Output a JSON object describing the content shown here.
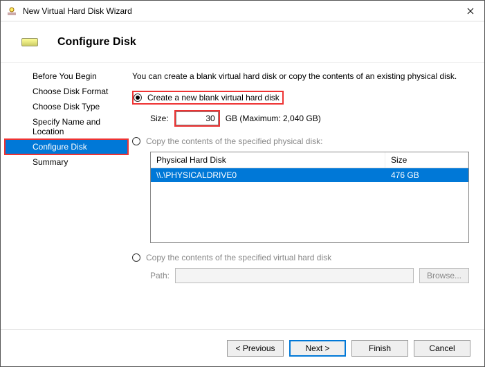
{
  "window": {
    "title": "New Virtual Hard Disk Wizard"
  },
  "header": {
    "title": "Configure Disk"
  },
  "nav": {
    "items": [
      {
        "label": "Before You Begin"
      },
      {
        "label": "Choose Disk Format"
      },
      {
        "label": "Choose Disk Type"
      },
      {
        "label": "Specify Name and Location"
      },
      {
        "label": "Configure Disk"
      },
      {
        "label": "Summary"
      }
    ],
    "current_index": 4
  },
  "content": {
    "description": "You can create a blank virtual hard disk or copy the contents of an existing physical disk.",
    "option_blank": "Create a new blank virtual hard disk",
    "size_label": "Size:",
    "size_value": "30",
    "size_unit": "GB (Maximum: 2,040 GB)",
    "option_copy_physical": "Copy the contents of the specified physical disk:",
    "disk_table": {
      "col_disk": "Physical Hard Disk",
      "col_size": "Size",
      "rows": [
        {
          "name": "\\\\.\\PHYSICALDRIVE0",
          "size": "476 GB"
        }
      ]
    },
    "option_copy_virtual": "Copy the contents of the specified virtual hard disk",
    "path_label": "Path:",
    "browse_label": "Browse..."
  },
  "footer": {
    "previous": "< Previous",
    "next": "Next >",
    "finish": "Finish",
    "cancel": "Cancel"
  }
}
